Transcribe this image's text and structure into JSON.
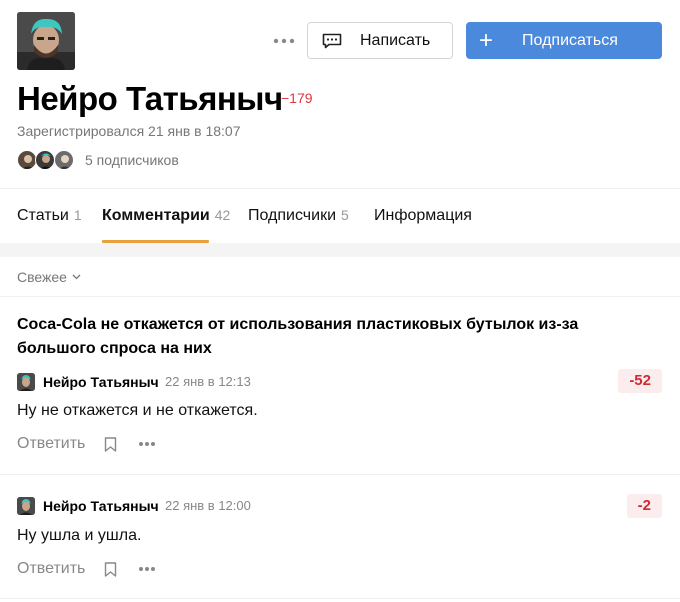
{
  "profile": {
    "name": "Нейро Татьяныч",
    "karma": "−179",
    "registered": "Зарегистрировался 21 янв в 18:07",
    "subscribers_text": "5 подписчиков",
    "write_label": "Написать",
    "subscribe_label": "Подписаться",
    "subscribe_icon": "+"
  },
  "tabs": [
    {
      "label": "Статьи",
      "count": "1"
    },
    {
      "label": "Комментарии",
      "count": "42"
    },
    {
      "label": "Подписчики",
      "count": "5"
    },
    {
      "label": "Информация",
      "count": ""
    }
  ],
  "sort": {
    "label": "Свежее"
  },
  "post": {
    "title": "Coca-Cola не откажется от использования пластиковых бутылок из-за большого спроса на них"
  },
  "comments": [
    {
      "author": "Нейро Татьяныч",
      "date": "22 янв в 12:13",
      "score": "-52",
      "text": "Ну не откажется и не откажется.",
      "reply_label": "Ответить"
    },
    {
      "author": "Нейро Татьяныч",
      "date": "22 янв в 12:00",
      "score": "-2",
      "text": "Ну ушла и ушла.",
      "reply_label": "Ответить"
    }
  ],
  "colors": {
    "accent": "#4a89dc",
    "karma_negative": "#e0383e",
    "tab_underline": "#e8a13c",
    "score_bg": "#fbeced"
  }
}
